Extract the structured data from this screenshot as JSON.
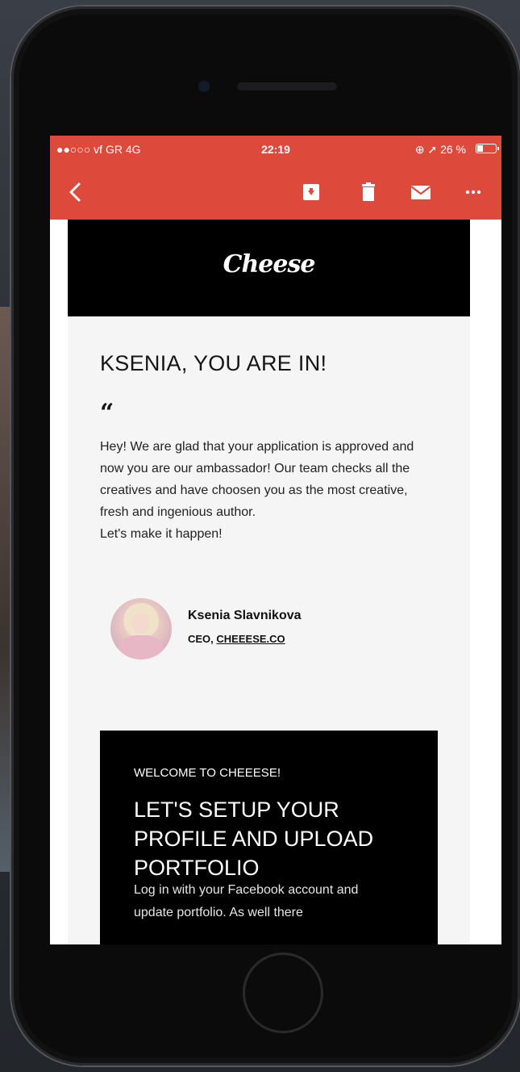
{
  "status_bar": {
    "carrier": "●●○○○ vf GR  4G",
    "time": "22:19",
    "right": "⊕ ➚ 26 %"
  },
  "toolbar": {
    "icons": [
      "back-icon",
      "archive-icon",
      "delete-icon",
      "mail-icon",
      "more-icon"
    ],
    "more_label": "•••"
  },
  "email": {
    "logo": "Cheese",
    "heading": "KSENIA, YOU ARE IN!",
    "quote_mark": "“",
    "body_lines": [
      "Hey! We are glad that your application is approved and now you are our ambassador! Our team checks all the creatives and have choosen you as the most creative, fresh and ingenious author.",
      "Let's make it happen!"
    ],
    "signature": {
      "name": "Ksenia Slavnikova",
      "title_prefix": "CEO, ",
      "title_link": "CHEEESE.CO"
    },
    "card": {
      "eyebrow": "WELCOME TO CHEEESE!",
      "title": "LET'S SETUP YOUR PROFILE AND UPLOAD PORTFOLIO",
      "text": "Log in with your Facebook account and update portfolio. As well there"
    }
  },
  "colors": {
    "header_red": "#dd4a3c",
    "banner_black": "#000000",
    "email_bg": "#f5f5f5"
  }
}
